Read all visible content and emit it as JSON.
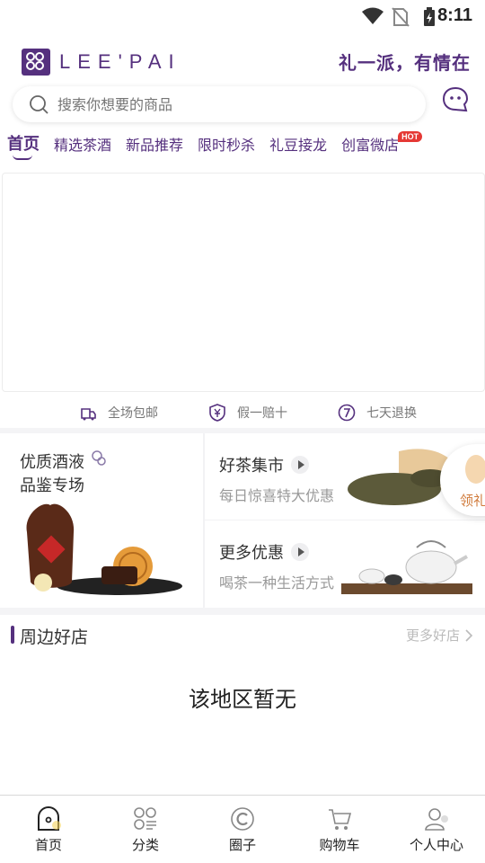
{
  "status_bar": {
    "time": "8:11"
  },
  "header": {
    "logo_text": "LEE'PAI",
    "slogan": "礼一派，有情在"
  },
  "search": {
    "placeholder": "搜索你想要的商品"
  },
  "tabs": [
    {
      "label": "首页",
      "active": true
    },
    {
      "label": "精选茶酒"
    },
    {
      "label": "新品推荐"
    },
    {
      "label": "限时秒杀"
    },
    {
      "label": "礼豆接龙"
    },
    {
      "label": "创富微店",
      "badge": "HOT"
    }
  ],
  "guarantees": [
    {
      "label": "全场包邮",
      "icon": "free-shipping-icon"
    },
    {
      "label": "假一赔十",
      "icon": "shield-yen-icon"
    },
    {
      "label": "七天退换",
      "icon": "seven-day-return-icon"
    }
  ],
  "promo": {
    "left": {
      "line1": "优质酒液",
      "line2": "品鉴专场"
    },
    "right": [
      {
        "title": "好茶集市",
        "subtitle": "每日惊喜特大优惠"
      },
      {
        "title": "更多优惠",
        "subtitle": "喝茶一种生活方式"
      }
    ],
    "gift_bubble": "领礼"
  },
  "stores": {
    "title": "周边好店",
    "more": "更多好店",
    "empty": "该地区暂无"
  },
  "bottom_nav": [
    {
      "label": "首页",
      "icon": "home-icon"
    },
    {
      "label": "分类",
      "icon": "category-icon"
    },
    {
      "label": "圈子",
      "icon": "circle-icon"
    },
    {
      "label": "购物车",
      "icon": "cart-icon"
    },
    {
      "label": "个人中心",
      "icon": "profile-icon"
    }
  ],
  "colors": {
    "brand": "#55307e",
    "hot": "#e53935",
    "gift_text": "#d07a3a"
  }
}
